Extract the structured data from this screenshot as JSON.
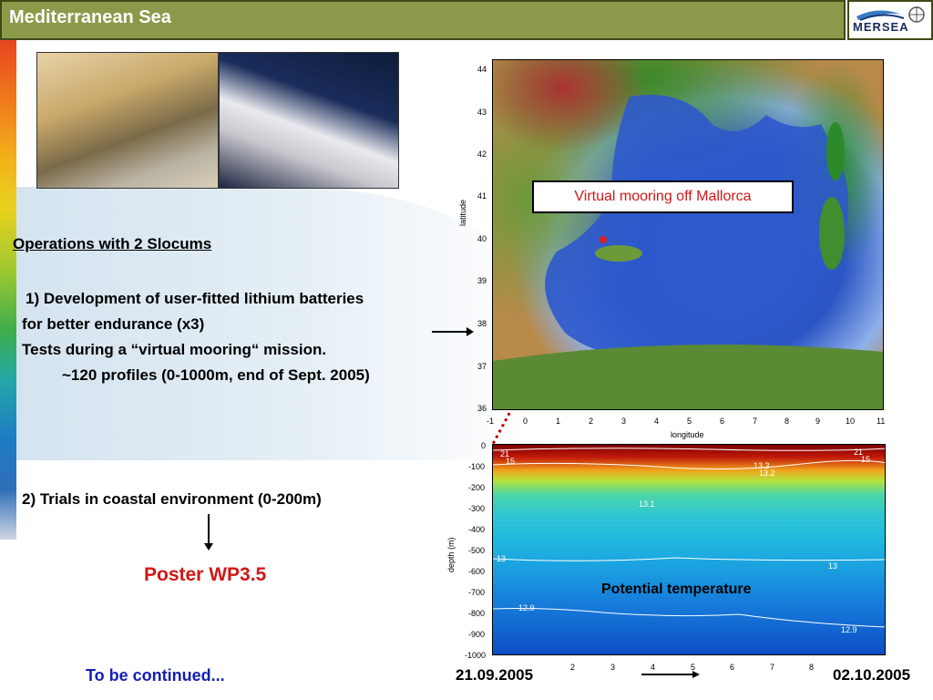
{
  "header": {
    "title": "Mediterranean Sea",
    "logo_text": "MERSEA"
  },
  "text": {
    "operations": "Operations with 2 Slocums",
    "item1_line1": "1) Development of user-fitted lithium batteries",
    "item1_line2": "for better endurance (x3)",
    "item1_line3": "Tests during a “virtual mooring“ mission.",
    "item1_line4": "~120 profiles (0-1000m, end of Sept. 2005)",
    "item2": "2) Trials in coastal environment (0-200m)",
    "poster": "Poster WP3.5",
    "continued": "To be continued...",
    "date_start": "21.09.2005",
    "date_end": "02.10.2005"
  },
  "map": {
    "callout": "Virtual mooring off Mallorca",
    "xlabel": "longitude",
    "ylabel": "latitude",
    "x_ticks": [
      "-1",
      "0",
      "1",
      "2",
      "3",
      "4",
      "5",
      "6",
      "7",
      "8",
      "9",
      "10",
      "11"
    ],
    "y_ticks": [
      "44",
      "43",
      "42",
      "41",
      "40",
      "39",
      "38",
      "37",
      "36"
    ]
  },
  "section": {
    "label": "Potential temperature",
    "ylabel": "depth (m)",
    "y_ticks": [
      "0",
      "-100",
      "-200",
      "-300",
      "-400",
      "-500",
      "-600",
      "-700",
      "-800",
      "-900",
      "-1000"
    ],
    "x_ticks": [
      "2",
      "3",
      "4",
      "5",
      "6",
      "7",
      "8"
    ],
    "contour_labels": [
      "21",
      "15",
      "21",
      "15",
      "13.3",
      "13.2",
      "13.1",
      "13",
      "13",
      "12.9",
      "12.9"
    ]
  },
  "colors": {
    "titlebar": "#8a9a4a",
    "accent_red": "#d01818",
    "accent_blue": "#1520b0"
  }
}
